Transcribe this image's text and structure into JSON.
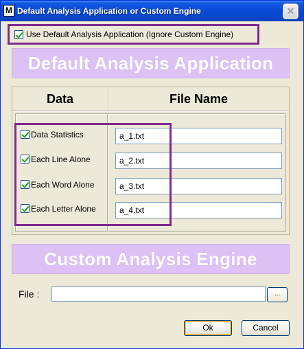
{
  "window": {
    "title": "Default Analysis Application or Custom Engine",
    "app_icon_letter": "M",
    "close_glyph": "✕"
  },
  "use_default": {
    "label": "Use Default Analysis Application (Ignore Custom Engine)",
    "checked": true
  },
  "default_section": {
    "banner": "Default Analysis Application",
    "columns": [
      "Data",
      "File Name"
    ],
    "rows": [
      {
        "label": "Data Statistics",
        "checked": true,
        "file": "a_1.txt"
      },
      {
        "label": "Each Line Alone",
        "checked": true,
        "file": "a_2.txt"
      },
      {
        "label": "Each Word Alone",
        "checked": true,
        "file": "a_3.txt"
      },
      {
        "label": "Each Letter Alone",
        "checked": true,
        "file": "a_4.txt"
      }
    ]
  },
  "custom_section": {
    "banner": "Custom Analysis Engine",
    "file_label": "File :",
    "file_value": "",
    "browse_label": "..."
  },
  "buttons": {
    "ok": "Ok",
    "cancel": "Cancel"
  },
  "colors": {
    "highlight_border": "#7d2a8e",
    "banner_bg": "#ddc1f5",
    "check_mark": "#21a121"
  }
}
